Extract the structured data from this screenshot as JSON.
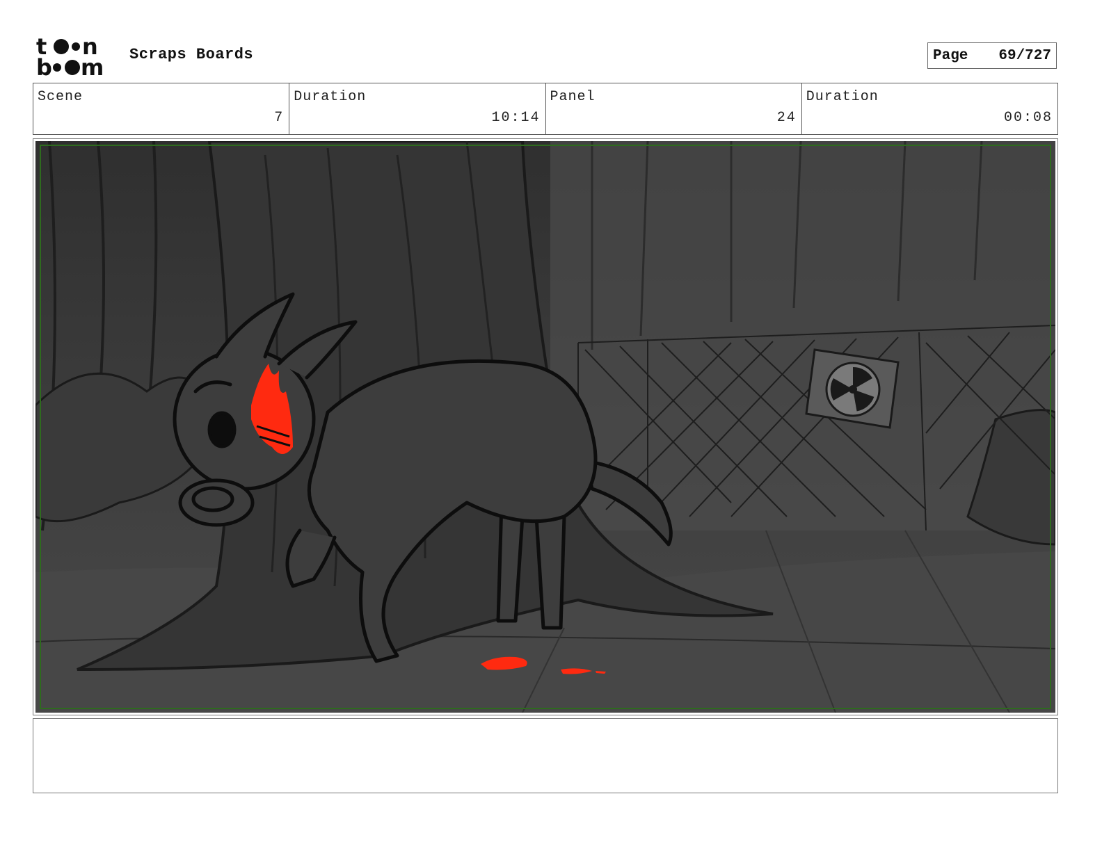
{
  "header": {
    "logo_text": "toon boom",
    "project_title": "Scraps Boards",
    "page_label": "Page",
    "page_value": "69/727"
  },
  "info": [
    {
      "label": "Scene",
      "value": "7"
    },
    {
      "label": "Duration",
      "value": "10:14"
    },
    {
      "label": "Panel",
      "value": "24"
    },
    {
      "label": "Duration",
      "value": "00:08"
    }
  ],
  "notes": {
    "text": ""
  },
  "colors": {
    "accent_red": "#ff2a10",
    "panel_border_green": "#2e6b1e",
    "background_dark": "#3c3c3c"
  }
}
